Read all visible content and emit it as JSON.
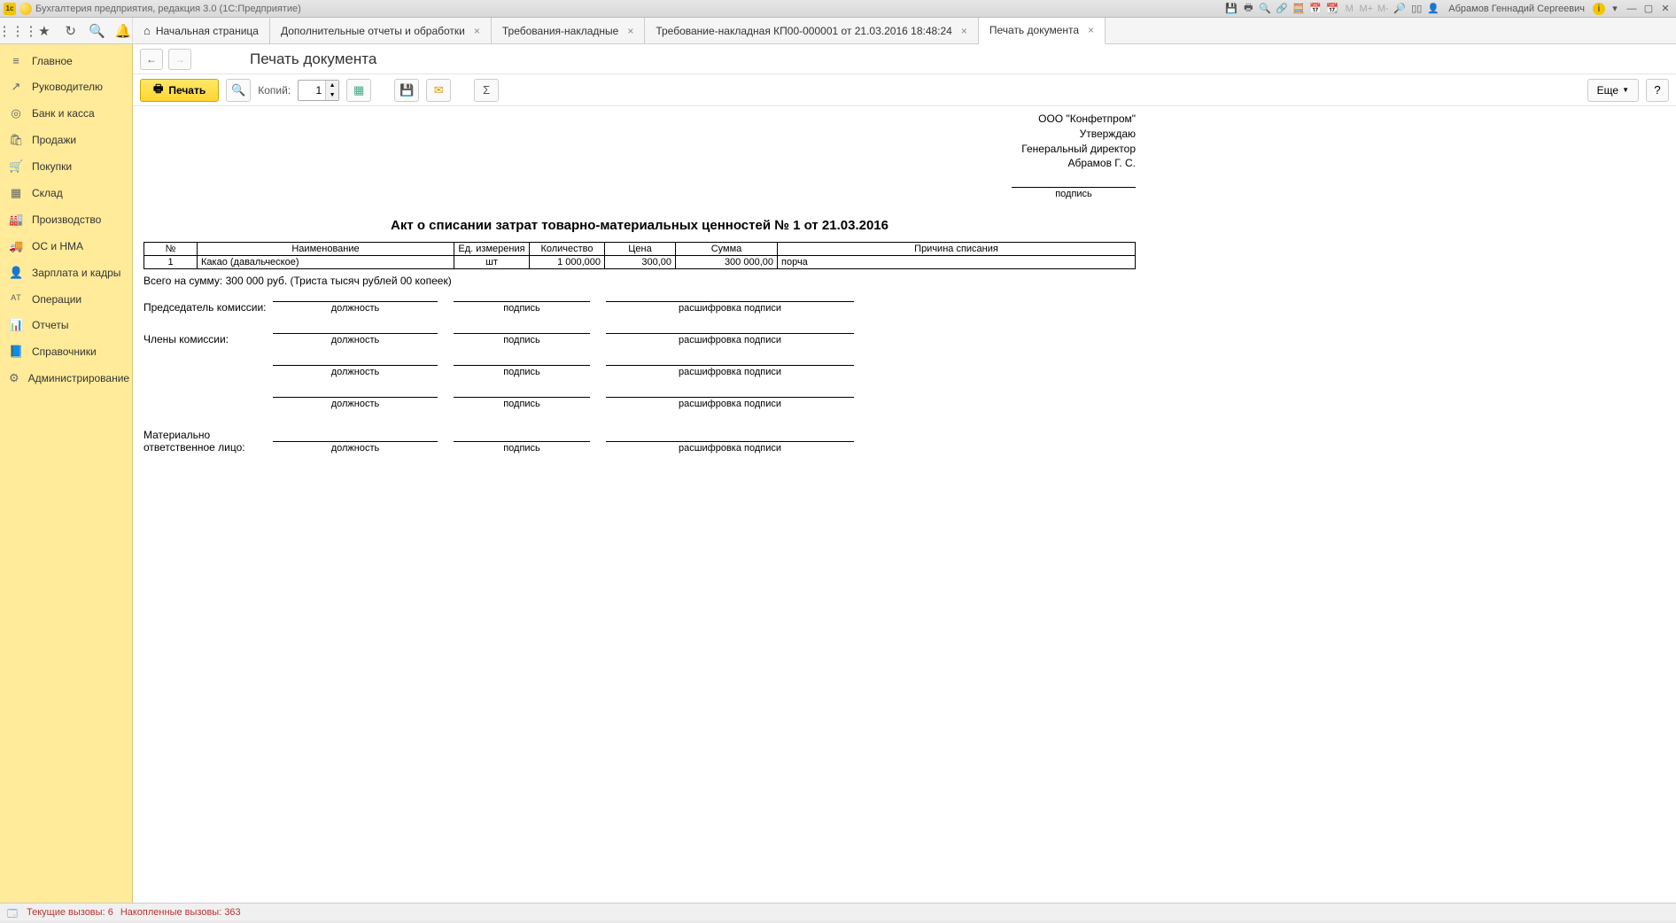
{
  "titlebar": {
    "app_title": "Бухгалтерия предприятия, редакция 3.0  (1С:Предприятие)",
    "user": "Абрамов Геннадий Сергеевич"
  },
  "tabs": [
    {
      "label": "Начальная страница",
      "closeable": false,
      "home": true
    },
    {
      "label": "Дополнительные отчеты и обработки",
      "closeable": true
    },
    {
      "label": "Требования-накладные",
      "closeable": true
    },
    {
      "label": "Требование-накладная КП00-000001 от 21.03.2016 18:48:24",
      "closeable": true
    },
    {
      "label": "Печать документа",
      "closeable": true,
      "active": true
    }
  ],
  "sidebar": [
    {
      "icon": "≡",
      "label": "Главное"
    },
    {
      "icon": "↗",
      "label": "Руководителю"
    },
    {
      "icon": "◎",
      "label": "Банк и касса"
    },
    {
      "icon": "🛍",
      "label": "Продажи"
    },
    {
      "icon": "🛒",
      "label": "Покупки"
    },
    {
      "icon": "▦",
      "label": "Склад"
    },
    {
      "icon": "🏭",
      "label": "Производство"
    },
    {
      "icon": "🚚",
      "label": "ОС и НМА"
    },
    {
      "icon": "👤",
      "label": "Зарплата и кадры"
    },
    {
      "icon": "ᴬᵀ",
      "label": "Операции"
    },
    {
      "icon": "📊",
      "label": "Отчеты"
    },
    {
      "icon": "📘",
      "label": "Справочники"
    },
    {
      "icon": "⚙",
      "label": "Администрирование"
    }
  ],
  "page": {
    "title": "Печать документа",
    "print_btn": "Печать",
    "copies_label": "Копий:",
    "copies_value": "1",
    "more_btn": "Еще",
    "help_btn": "?"
  },
  "doc": {
    "org": "ООО \"Конфетпром\"",
    "approve": "Утверждаю",
    "position": "Генеральный директор",
    "person": "Абрамов Г. С.",
    "sig_caption": "подпись",
    "title": "Акт о списании затрат товарно-материальных ценностей № 1 от 21.03.2016",
    "headers": {
      "n": "№",
      "name": "Наименование",
      "unit": "Ед. измерения",
      "qty": "Количество",
      "price": "Цена",
      "sum": "Сумма",
      "reason": "Причина списания"
    },
    "rows": [
      {
        "n": "1",
        "name": "Какао (давальческое)",
        "unit": "шт",
        "qty": "1 000,000",
        "price": "300,00",
        "sum": "300 000,00",
        "reason": "порча"
      }
    ],
    "total": "Всего на сумму: 300 000 руб. (Триста тысяч рублей 00 копеек)",
    "chairman": "Председатель комиссии:",
    "members": "Члены комиссии:",
    "responsible1": "Материально",
    "responsible2": "ответственное лицо:",
    "cap_position": "должность",
    "cap_signature": "подпись",
    "cap_decrypt": "расшифровка подписи"
  },
  "status": {
    "calls_label": "Текущие вызовы:",
    "calls_value": "6",
    "acc_label": "Накопленные вызовы:",
    "acc_value": "363"
  }
}
